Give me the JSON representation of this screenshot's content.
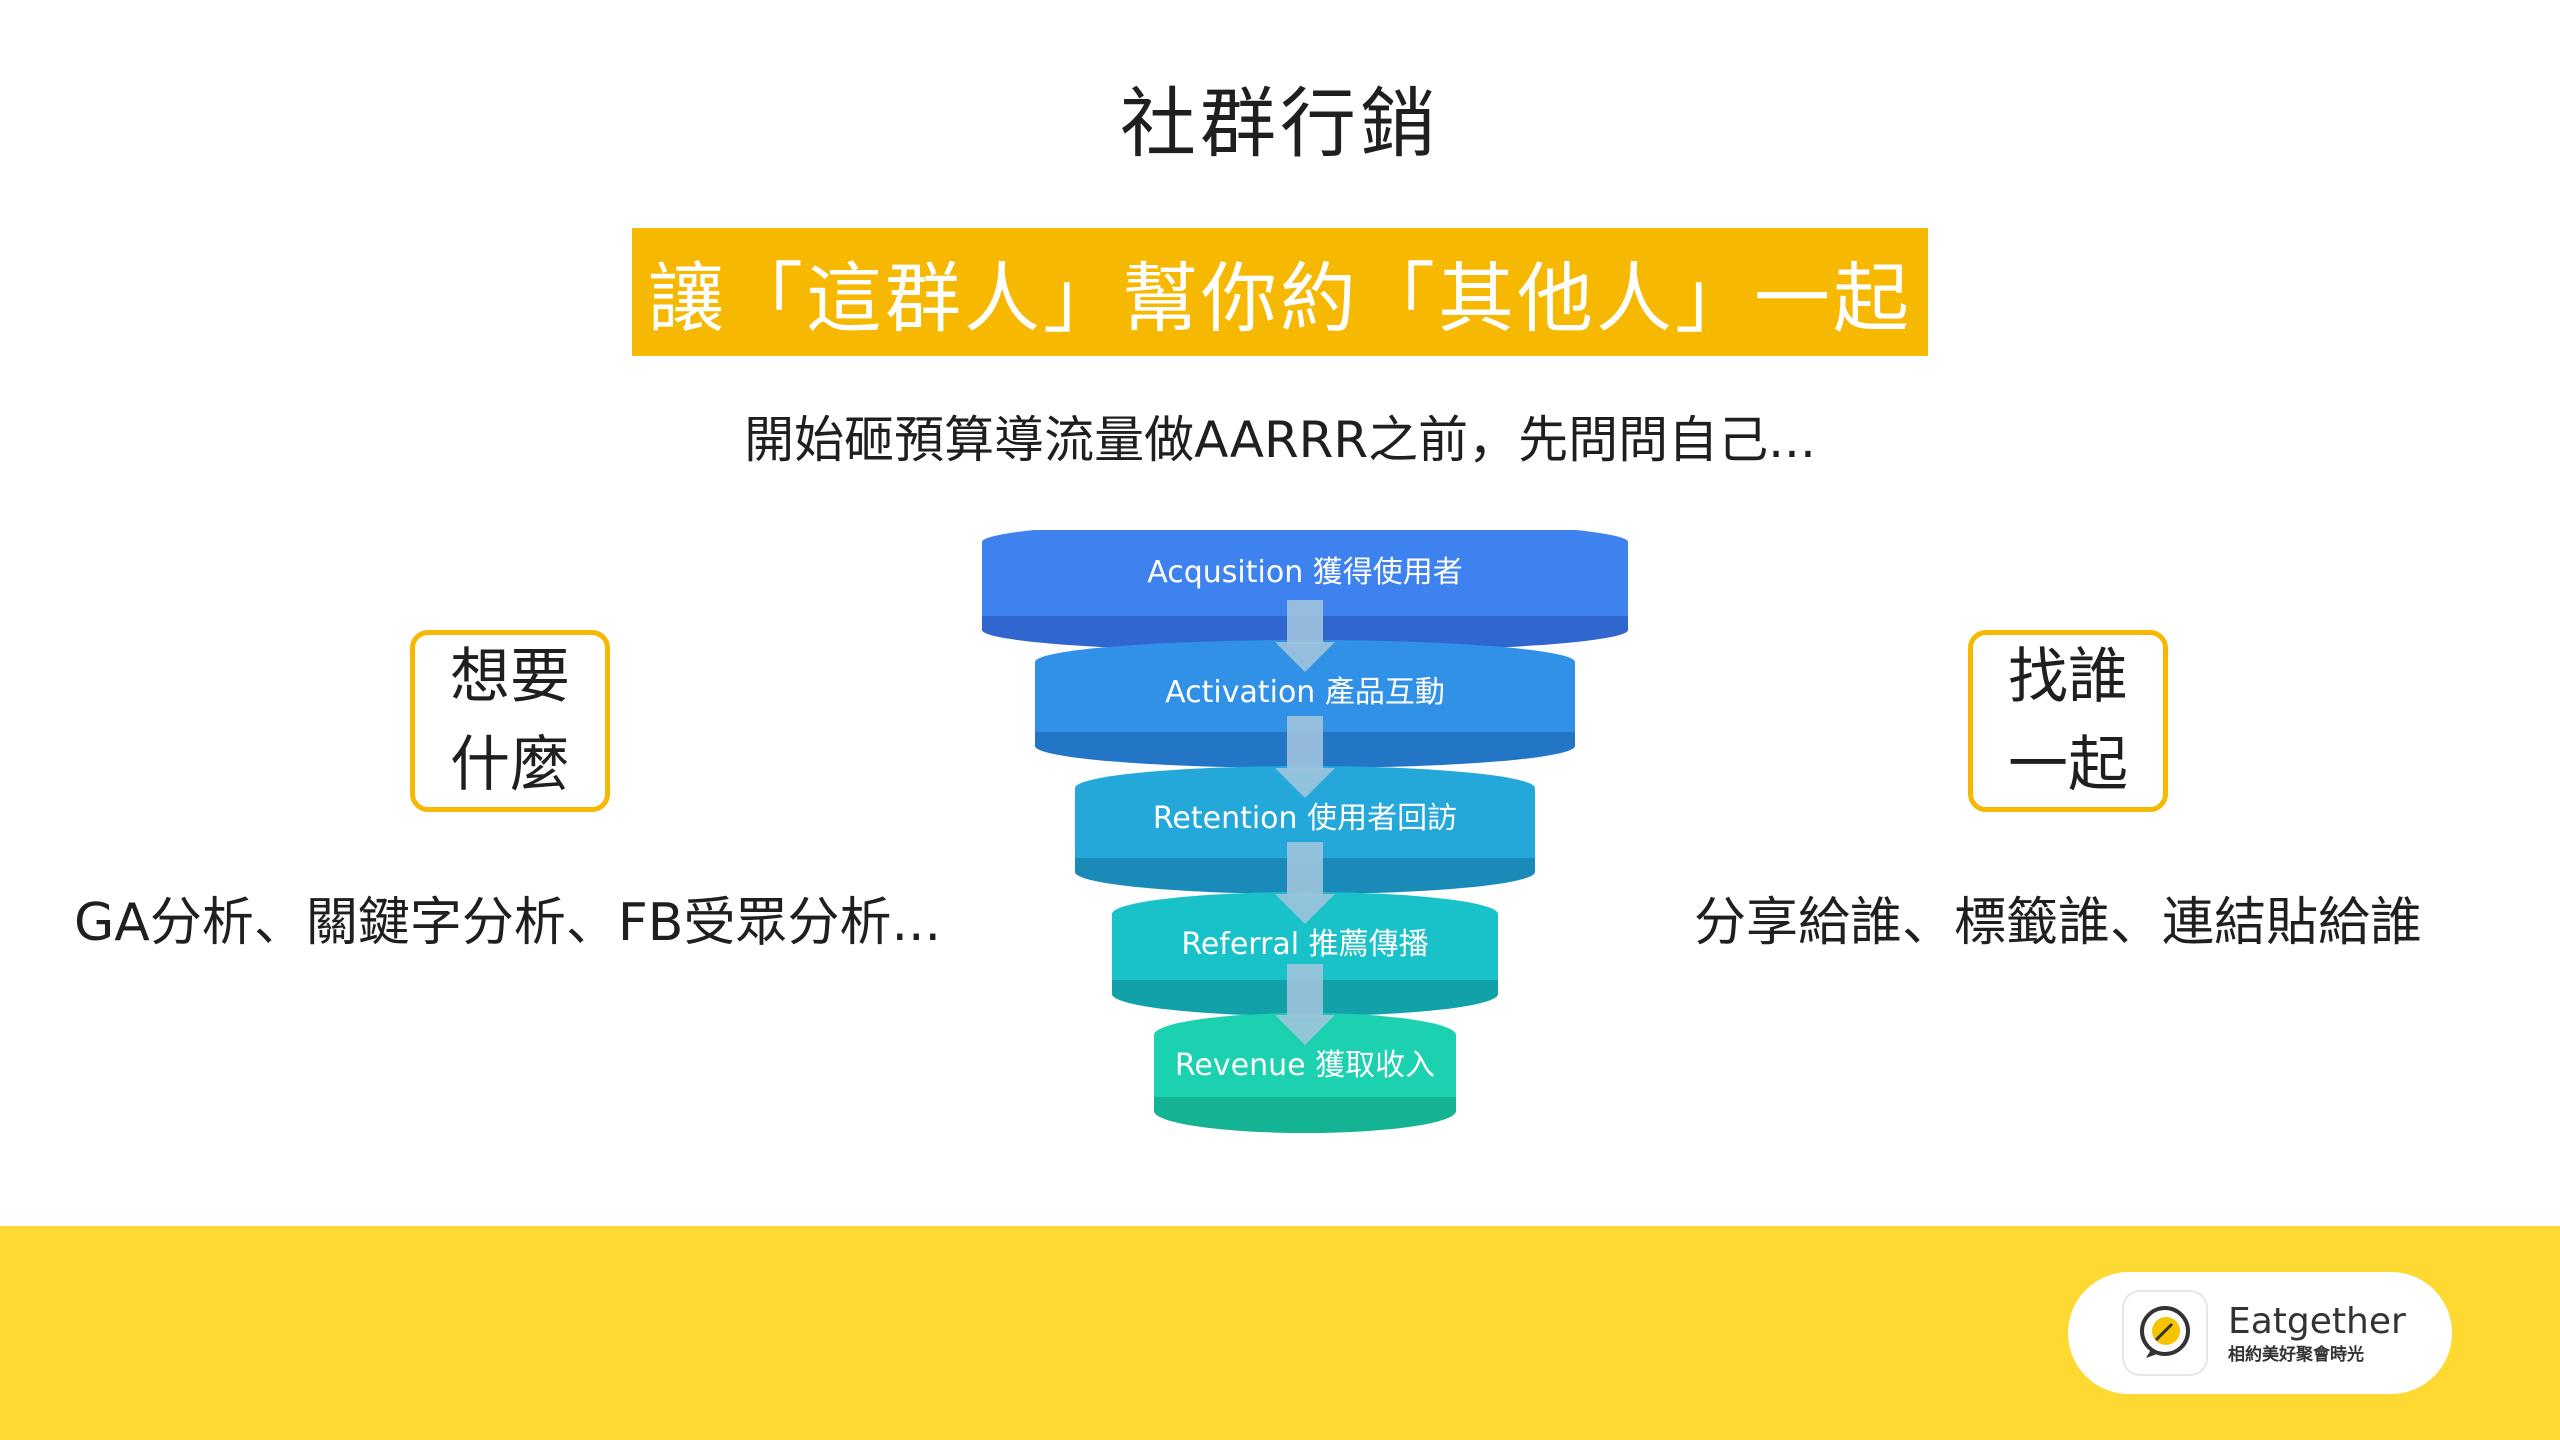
{
  "title": "社群行銷",
  "banner": "讓「這群人」幫你約「其他人」一起",
  "subtitle": "開始砸預算導流量做AARRR之前，先問問自己...",
  "left": {
    "box_line1": "想要",
    "box_line2": "什麼",
    "caption": "GA分析、關鍵字分析、FB受眾分析..."
  },
  "right": {
    "box_line1": "找誰",
    "box_line2": "一起",
    "caption": "分享給誰、標籤誰、連結貼給誰"
  },
  "funnel": {
    "stages": [
      {
        "label": "Acqusition 獲得使用者",
        "color": "#3e82ef",
        "shade": "#2f67cf"
      },
      {
        "label": "Activation 產品互動",
        "color": "#3191e6",
        "shade": "#2375c6"
      },
      {
        "label": "Retention 使用者回訪",
        "color": "#23a8d9",
        "shade": "#1a8bb8"
      },
      {
        "label": "Referral 推薦傳播",
        "color": "#19c1c8",
        "shade": "#12a1a8"
      },
      {
        "label": "Revenue 獲取收入",
        "color": "#1bd1b0",
        "shade": "#14b394"
      }
    ]
  },
  "logo": {
    "name": "Eatgether",
    "tagline": "相約美好聚會時光"
  },
  "colors": {
    "accent": "#f6b800",
    "footer": "#fed931"
  }
}
